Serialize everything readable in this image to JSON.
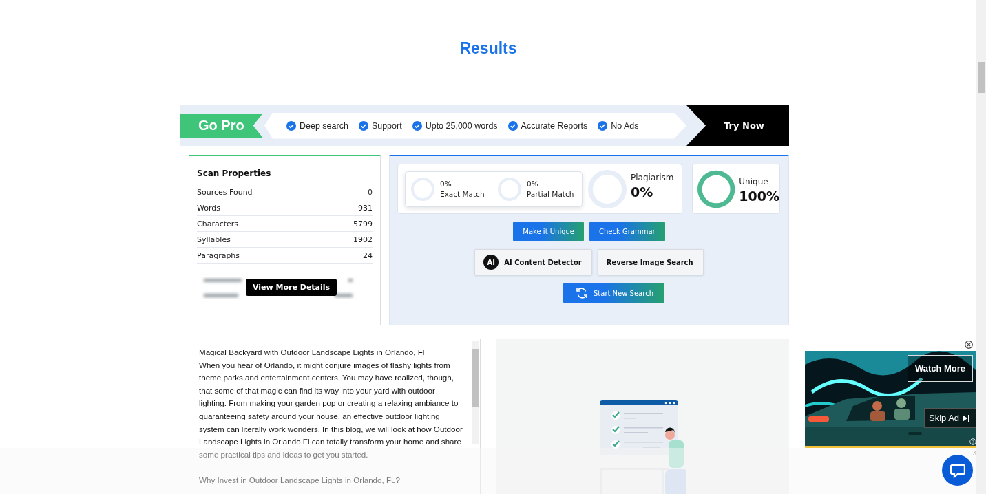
{
  "heading": {
    "title": "Results"
  },
  "promo": {
    "badge": "Go Pro",
    "features": [
      "Deep search",
      "Support",
      "Upto 25,000 words",
      "Accurate Reports",
      "No Ads"
    ],
    "button": "Try Now"
  },
  "scan_properties": {
    "title": "Scan Properties",
    "rows": [
      {
        "label": "Sources Found",
        "value": "0"
      },
      {
        "label": "Words",
        "value": "931"
      },
      {
        "label": "Characters",
        "value": "5799"
      },
      {
        "label": "Syllables",
        "value": "1902"
      },
      {
        "label": "Paragraphs",
        "value": "24"
      }
    ],
    "button": "View More Details"
  },
  "results": {
    "matches": [
      {
        "value": "0%",
        "label": "Exact Match"
      },
      {
        "value": "0%",
        "label": "Partial Match"
      }
    ],
    "plagiarism": {
      "label": "Plagiarism",
      "value": "0%"
    },
    "unique": {
      "label": "Unique",
      "value": "100%"
    },
    "action_rows": [
      [
        {
          "label": "Make it Unique",
          "kind": "gradient"
        },
        {
          "label": "Check Grammar",
          "kind": "gradient"
        }
      ],
      [
        {
          "label": "AI Content Detector",
          "kind": "ai",
          "badge": "AI"
        },
        {
          "label": "Reverse Image Search",
          "kind": "outline"
        }
      ],
      [
        {
          "label": "Start New Search",
          "kind": "restart"
        }
      ]
    ]
  },
  "document": {
    "title": "Magical Backyard with Outdoor Landscape Lights in Orlando, Fl",
    "paragraph": "When you hear of Orlando, it might conjure images of flashy lights from theme parks and entertainment centers. You may have realized, though, that some of that magic can find its way into your yard with outdoor lighting. From making your garden pop or creating a relaxing ambiance to guaranteeing safety around your house, an effective outdoor lighting system can literally work wonders. In this blog, we will look at how Outdoor Landscape Lights in Orlando Fl can totally transform your home and share some practical tips and ideas to get you started.",
    "subheading": "Why Invest in Outdoor Landscape Lights in Orlando, FL?"
  },
  "video_ad": {
    "watch_more": "Watch More",
    "skip": "Skip Ad"
  },
  "bottom_banner": {
    "close": "x"
  }
}
